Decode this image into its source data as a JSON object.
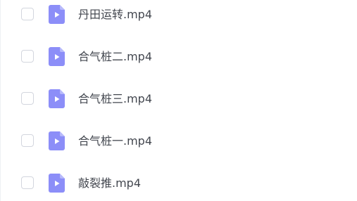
{
  "file_list": {
    "icon": "video-file-icon",
    "icon_color": "#8c8ef8",
    "items": [
      {
        "name": "丹田运转.mp4",
        "checked": false
      },
      {
        "name": "合气桩二.mp4",
        "checked": false
      },
      {
        "name": "合气桩三.mp4",
        "checked": false
      },
      {
        "name": "合气桩一.mp4",
        "checked": false
      },
      {
        "name": "敲裂推.mp4",
        "checked": false
      }
    ]
  }
}
